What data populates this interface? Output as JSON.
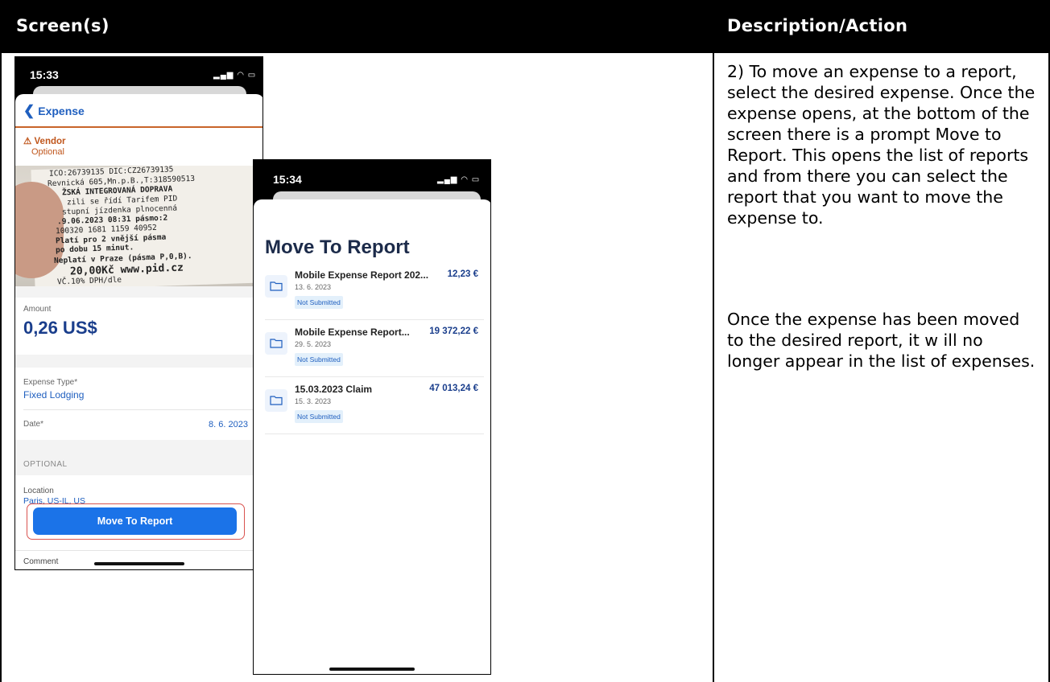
{
  "header": {
    "left": "Screen(s)",
    "right": "Description/Action"
  },
  "description": {
    "p1": "2) To move an expense to a report, select the desired expense. Once the expense opens, at the bottom of the screen there is a prompt Move to Report. This opens the list of reports and from there you can select the report that you want to move the expense to.",
    "p2": "Once the expense has been moved to the desired report, it w ill no longer appear in the list of expenses."
  },
  "phone1": {
    "time": "15:33",
    "signal": "▂▄▆ ◠ ▭",
    "back_label": "Expense",
    "vendor_label": "Vendor",
    "vendor_hint": "Optional",
    "receipt_lines": [
      "ICO:26739135    DIC:CZ26739135",
      "Revnická 605,Mn.p.B.,T:318590513",
      "ŽSKÁ INTEGROVANÁ DOPRAVA",
      "zili se řídí Tarifem PID",
      "stupní jízdenka plnocenná",
      ".9.06.2023  08:31   pásmo:2",
      "100320  1681   1159   40952",
      "Platí pro 2 vnější pásma",
      "po dobu 15 minut.",
      "Neplatí v Praze (pásma P,0,B).",
      "20,00Kč www.pid.cz",
      "VČ.10% DPH/dle"
    ],
    "amount_label": "Amount",
    "amount_value": "0,26 US$",
    "expense_type_label": "Expense Type*",
    "expense_type_value": "Fixed Lodging",
    "date_label": "Date*",
    "date_value": "8. 6. 2023",
    "optional_header": "OPTIONAL",
    "location_label": "Location",
    "location_value": "Paris, US-IL, US",
    "move_button": "Move To Report",
    "comment_label": "Comment"
  },
  "phone2": {
    "time": "15:34",
    "signal": "▂▄▆ ◠ ▭",
    "title": "Move To Report",
    "reports": [
      {
        "name": "Mobile Expense Report 202...",
        "amount": "12,23 €",
        "date": "13. 6. 2023",
        "status": "Not Submitted"
      },
      {
        "name": "Mobile Expense Report...",
        "amount": "19 372,22 €",
        "date": "29. 5. 2023",
        "status": "Not Submitted"
      },
      {
        "name": "15.03.2023 Claim",
        "amount": "47 013,24 €",
        "date": "15. 3. 2023",
        "status": "Not Submitted"
      }
    ]
  },
  "colors": {
    "accent_blue": "#1b73e8",
    "amount_blue": "#1a3e8c",
    "warning_orange": "#c0561c",
    "highlight_red": "#d9534f"
  }
}
